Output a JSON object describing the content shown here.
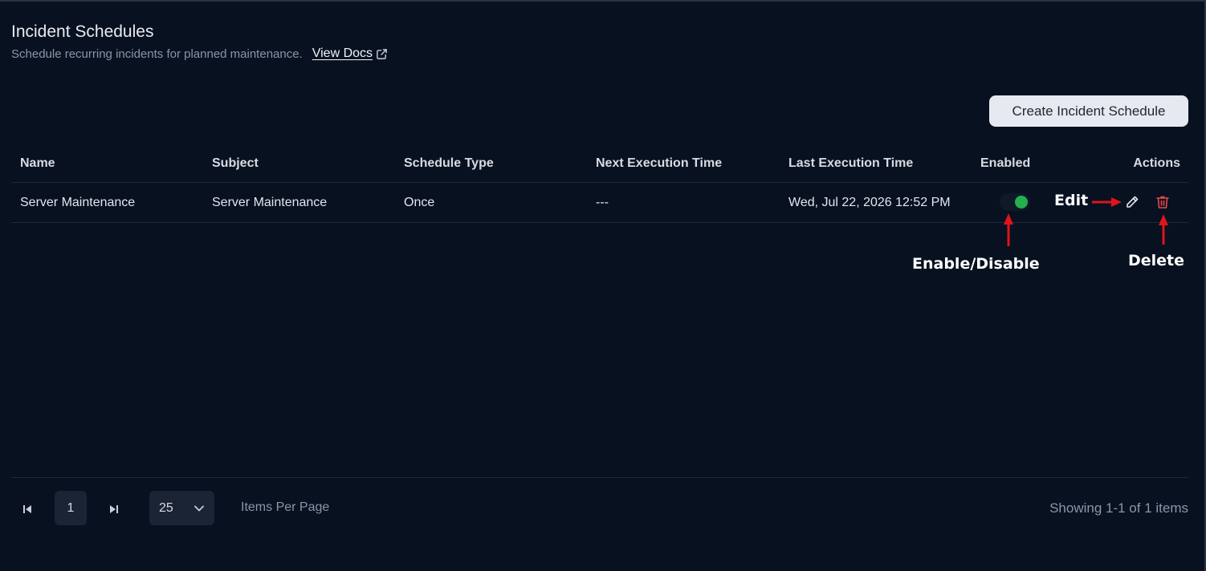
{
  "header": {
    "title": "Incident Schedules",
    "subtitle": "Schedule recurring incidents for planned maintenance.",
    "docs_link": "View Docs",
    "docs_icon": "external-link-icon"
  },
  "actions": {
    "create_label": "Create Incident Schedule"
  },
  "table": {
    "columns": [
      "Name",
      "Subject",
      "Schedule Type",
      "Next Execution Time",
      "Last Execution Time",
      "Enabled",
      "Actions"
    ],
    "rows": [
      {
        "name": "Server Maintenance",
        "subject": "Server Maintenance",
        "schedule_type": "Once",
        "next_execution": "---",
        "last_execution": "Wed, Jul 22, 2026 12:52 PM",
        "enabled": true,
        "edit_icon": "pencil-icon",
        "delete_icon": "trash-icon"
      }
    ]
  },
  "annotations": {
    "edit": "Edit",
    "enable_disable": "Enable/Disable",
    "delete": "Delete",
    "arrow_color": "#e0141a"
  },
  "pagination": {
    "current_page": "1",
    "items_per_page": "25",
    "items_per_page_label": "Items Per Page",
    "showing": "Showing 1-1 of 1 items"
  },
  "colors": {
    "background": "#081120",
    "toggle_on": "#22b14c",
    "delete": "#e5484d"
  }
}
